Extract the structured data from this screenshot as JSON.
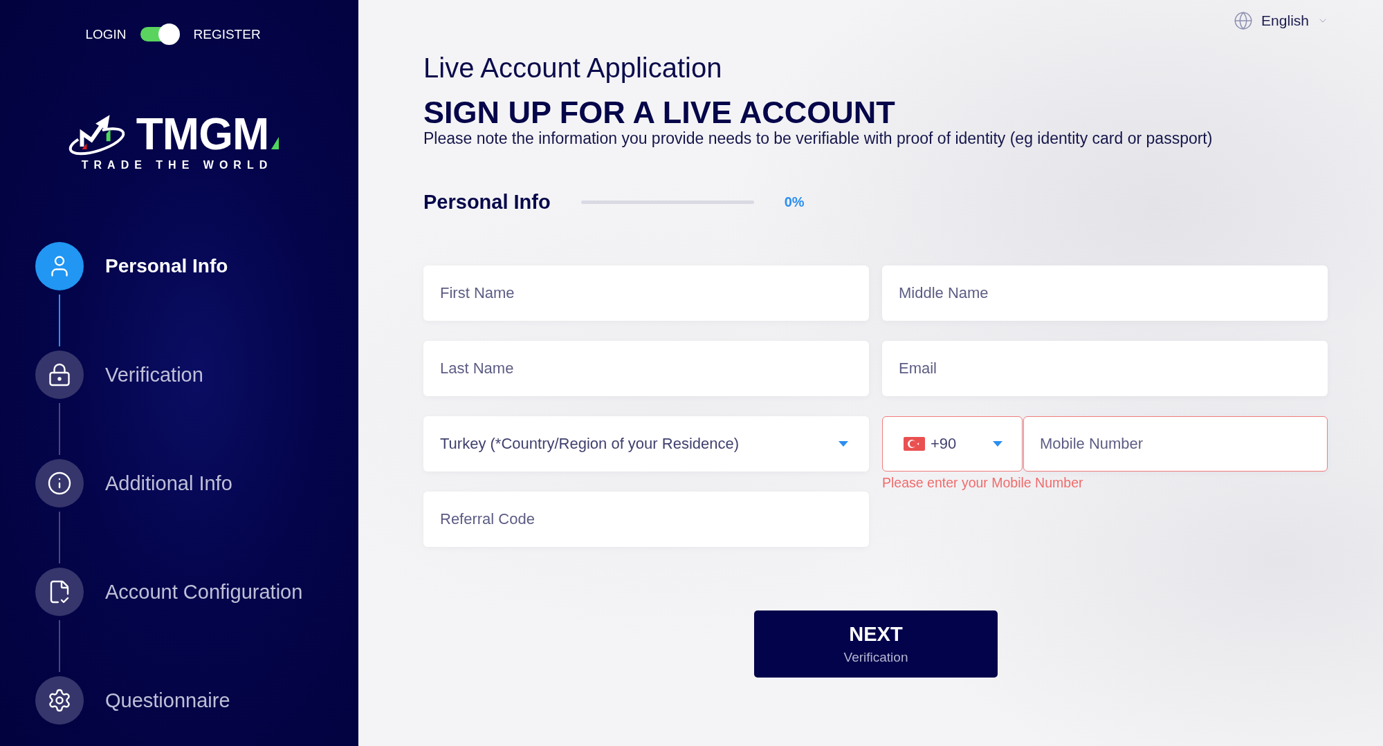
{
  "sidebar": {
    "auth_toggle": {
      "left_label": "LOGIN",
      "right_label": "REGISTER",
      "on": true
    },
    "logo": {
      "name": "TMGM",
      "tagline": "TRADE THE WORLD"
    },
    "steps": [
      {
        "label": "Personal Info",
        "selected": true
      },
      {
        "label": "Verification",
        "selected": false
      },
      {
        "label": "Additional Info",
        "selected": false
      },
      {
        "label": "Account Configuration",
        "selected": false
      },
      {
        "label": "Questionnaire",
        "selected": false
      }
    ]
  },
  "language": {
    "label": "English"
  },
  "header": {
    "kicker": "Live Account Application",
    "title": "SIGN UP FOR A LIVE ACCOUNT",
    "note": "Please note the information you provide needs to be verifiable with proof of identity (eg identity card or passport)"
  },
  "progress": {
    "label": "Personal Info",
    "level": 0,
    "reading": "0%"
  },
  "form": {
    "columns": [
      {
        "fields": [
          {
            "kind": "text",
            "placeholder": "First Name"
          },
          {
            "kind": "text",
            "placeholder": "Last Name"
          },
          {
            "kind": "select",
            "value": "Turkey (*Country/Region of your Residence)"
          },
          {
            "kind": "text",
            "placeholder": "Referral Code"
          }
        ]
      },
      {
        "fields": [
          {
            "kind": "text",
            "placeholder": "Middle Name"
          },
          {
            "kind": "text",
            "placeholder": "Email"
          },
          {
            "kind": "phone",
            "code": "+90",
            "placeholder": "Mobile Number",
            "invalid": true,
            "error": "Please enter your Mobile Number"
          }
        ]
      }
    ]
  },
  "next_button": {
    "label": "NEXT",
    "sublabel": "Verification"
  }
}
